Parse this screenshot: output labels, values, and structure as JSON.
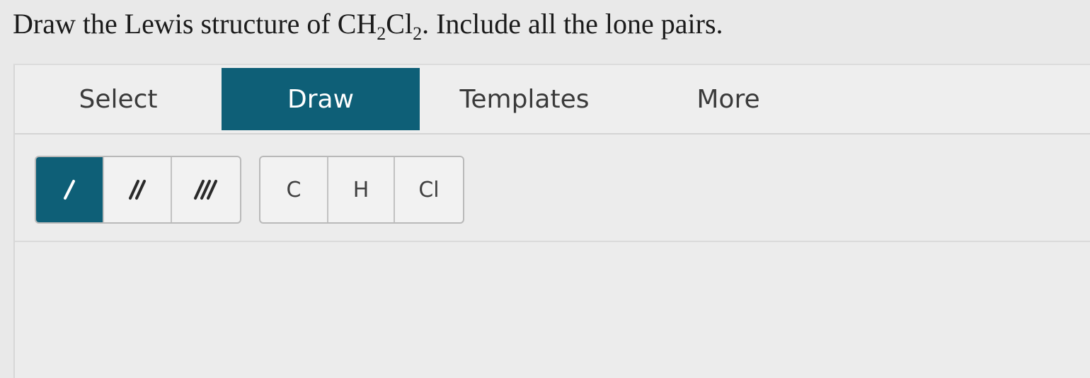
{
  "question": {
    "prefix": "Draw the Lewis structure of CH",
    "sub1": "2",
    "mid": "Cl",
    "sub2": "2",
    "suffix": ". Include all the lone pairs."
  },
  "tabs": [
    {
      "label": "Select",
      "active": false
    },
    {
      "label": "Draw",
      "active": true
    },
    {
      "label": "Templates",
      "active": false
    },
    {
      "label": "More",
      "active": false
    }
  ],
  "bond_tools": [
    {
      "icon": "single-bond-icon",
      "active": true
    },
    {
      "icon": "double-bond-icon",
      "active": false
    },
    {
      "icon": "triple-bond-icon",
      "active": false
    }
  ],
  "atom_tools": [
    "C",
    "H",
    "Cl"
  ],
  "colors": {
    "accent": "#0e5f77",
    "background": "#e9e9e9"
  }
}
